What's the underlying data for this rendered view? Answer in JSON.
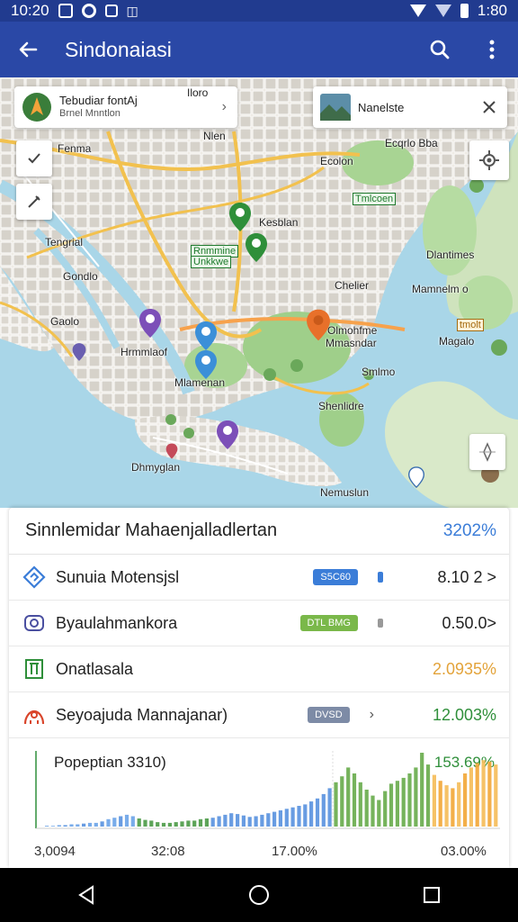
{
  "status_bar": {
    "time": "10:20",
    "right_text": "1:80"
  },
  "app_bar": {
    "title": "Sindonaiasi"
  },
  "map": {
    "search_card": {
      "title": "Tebudiar fontAj",
      "subtitle": "Brnel Mnntlon"
    },
    "place_card": {
      "title": "Nanelste"
    },
    "labels": [
      "Fenma",
      "Ecolon",
      "Gaolo",
      "Tengrial",
      "Gondlo",
      "Iloro",
      "Nlen",
      "Kesblan",
      "Chelier",
      "Dlantimes",
      "Ecqrlo Bba",
      "Mamnelm o",
      "Magalo",
      "Hrmmlaof",
      "Mlamenan",
      "Olmohfme",
      "Mmasndar",
      "Smlmo",
      "Shenlidre",
      "Dhmyglan",
      "Nemuslun"
    ],
    "tags": [
      "Tmlcoen",
      "Rnmmine",
      "Unkkwe",
      "tmolt"
    ]
  },
  "sheet": {
    "header_title": "Sinnlemidar Mahaenjalladlertan",
    "header_value": "3202%",
    "rows": [
      {
        "label": "Sunuia Motensjsl",
        "badge": "S5C60",
        "value": "8.10 2 >"
      },
      {
        "label": "Byaulahmankora",
        "badge": "DTL BMG",
        "value": "0.50.0>"
      },
      {
        "label": "Onatlasala",
        "badge": "",
        "value": "2.0935%"
      },
      {
        "label": "Seyoajuda Mannajanar)",
        "badge": "DVSD",
        "value": "12.003%"
      }
    ],
    "chart": {
      "title": "Popeptian 3310)",
      "value_label": "153.69%",
      "x_labels": [
        "3,0094",
        "32:08",
        "17.00%",
        "03.00%"
      ]
    }
  },
  "colors": {
    "primary": "#2a48a6",
    "status_bar": "#213b8f",
    "green": "#3a9a3d",
    "blue": "#3b7dd8",
    "orange": "#e3a33a"
  },
  "chart_data": {
    "type": "bar",
    "series": [
      {
        "color": "#4f9c4a",
        "values": [
          1,
          1,
          2,
          2,
          3,
          3,
          4,
          5,
          5,
          7,
          10,
          12,
          14,
          16,
          14,
          11,
          9,
          8,
          6,
          5,
          5,
          6,
          7,
          8,
          8,
          10,
          11,
          12,
          14,
          16,
          18,
          17,
          15,
          13,
          14,
          16,
          18,
          20,
          22,
          24,
          26,
          28,
          30,
          34,
          38,
          44,
          52,
          60,
          68,
          80,
          72,
          60,
          50,
          42,
          36,
          48,
          58,
          62,
          66,
          72,
          80,
          100,
          84,
          70,
          62,
          56,
          52,
          60,
          72,
          80,
          86,
          90,
          88,
          84
        ]
      },
      {
        "color": "#5b94e0",
        "values": []
      }
    ]
  }
}
